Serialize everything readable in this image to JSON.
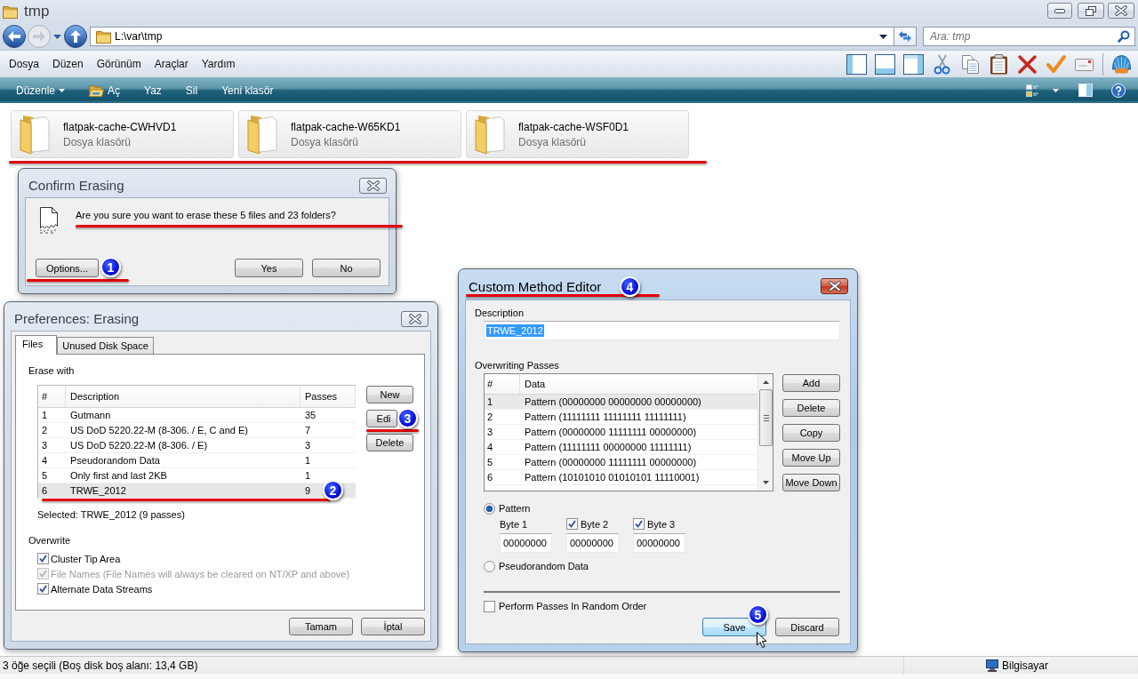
{
  "window": {
    "title": "tmp"
  },
  "address_bar": {
    "path": "L:\\var\\tmp",
    "search": {
      "placeholder": "Ara: tmp"
    }
  },
  "menu_bar": [
    "Dosya",
    "Düzen",
    "Görünüm",
    "Araçlar",
    "Yardım"
  ],
  "command_bar": [
    {
      "label": "Düzenle",
      "kind": "dropdown"
    },
    {
      "label": "Aç",
      "kind": "icon"
    },
    {
      "label": "Yaz",
      "kind": "plain"
    },
    {
      "label": "Sil",
      "kind": "plain"
    },
    {
      "label": "Yeni klasör",
      "kind": "plain"
    }
  ],
  "folders": {
    "underlined": true,
    "items": [
      {
        "name": "flatpak-cache-CWHVD1",
        "type": "Dosya klasörü"
      },
      {
        "name": "flatpak-cache-W65KD1",
        "type": "Dosya klasörü"
      },
      {
        "name": "flatpak-cache-WSF0D1",
        "type": "Dosya klasörü"
      }
    ]
  },
  "confirm_erasing": {
    "active": false,
    "title": "Confirm Erasing",
    "message": "Are you sure you want to erase these 5 files and 23 folders?",
    "message_underlined": true,
    "buttons": [
      {
        "label": "Options...",
        "underlined": true,
        "callout": "1"
      },
      {
        "label": "Yes",
        "underlined": false
      },
      {
        "label": "No",
        "underlined": false
      }
    ]
  },
  "preferences": {
    "active": false,
    "title": "Preferences: Erasing",
    "tabs": [
      {
        "label": "Files",
        "selected": true
      },
      {
        "label": "Unused Disk Space",
        "selected": false
      }
    ],
    "erase_with_label": "Erase with",
    "methods_table": {
      "columns": [
        "#",
        "Description",
        "Passes"
      ],
      "rows": [
        {
          "number": "1",
          "description": "Gutmann",
          "passes": "35",
          "selected": false,
          "underlined": false
        },
        {
          "number": "2",
          "description": "US DoD 5220.22-M (8-306. / E, C and E)",
          "passes": "7",
          "selected": false,
          "underlined": false
        },
        {
          "number": "3",
          "description": "US DoD 5220.22-M (8-306. / E)",
          "passes": "3",
          "selected": false,
          "underlined": false
        },
        {
          "number": "4",
          "description": "Pseudorandom Data",
          "passes": "1",
          "selected": false,
          "underlined": false
        },
        {
          "number": "5",
          "description": "Only first and last 2KB",
          "passes": "1",
          "selected": false,
          "underlined": false
        },
        {
          "number": "6",
          "description": "TRWE_2012",
          "passes": "9",
          "selected": true,
          "underlined": true,
          "callout": "2"
        }
      ]
    },
    "side_buttons": [
      {
        "label": "New",
        "underlined": false
      },
      {
        "label": "Edi",
        "underlined": true,
        "callout": "3"
      },
      {
        "label": "Delete",
        "underlined": false
      }
    ],
    "selected_summary": "Selected: TRWE_2012 (9 passes)",
    "overwrite_label": "Overwrite",
    "overwrite_options": [
      {
        "label": "Cluster Tip Area",
        "checked": true,
        "disabled": false
      },
      {
        "label": "File Names (File Names will always be cleared on NT/XP and above)",
        "checked": true,
        "disabled": true
      },
      {
        "label": "Alternate Data Streams",
        "checked": true,
        "disabled": false
      }
    ],
    "buttons": [
      "Tamam",
      "İptal"
    ]
  },
  "custom_method_editor": {
    "active": true,
    "title": "Custom Method Editor",
    "title_underlined": true,
    "title_callout": "4",
    "description_label": "Description",
    "description": {
      "value": "TRWE_2012",
      "text_selected": true
    },
    "passes_label": "Overwriting Passes",
    "passes_table": {
      "columns": [
        "#",
        "Data"
      ],
      "rows": [
        {
          "number": "1",
          "data": "Pattern (00000000 00000000 00000000)",
          "selected": true
        },
        {
          "number": "2",
          "data": "Pattern (11111111 11111111 11111111)",
          "selected": false
        },
        {
          "number": "3",
          "data": "Pattern (00000000 11111111 00000000)",
          "selected": false
        },
        {
          "number": "4",
          "data": "Pattern (11111111 00000000 11111111)",
          "selected": false
        },
        {
          "number": "5",
          "data": "Pattern (00000000 11111111 00000000)",
          "selected": false
        },
        {
          "number": "6",
          "data": "Pattern (10101010 01010101 11110001)",
          "selected": false
        }
      ]
    },
    "side_buttons": [
      "Add",
      "Delete",
      "Copy",
      "Move Up",
      "Move Down"
    ],
    "modes": [
      {
        "label": "Pattern",
        "selected": true
      },
      {
        "label": "Pseudorandom Data",
        "selected": false
      }
    ],
    "bytes": [
      {
        "label": "Byte 1",
        "kind": "label",
        "value": "00000000"
      },
      {
        "label": "Byte 2",
        "kind": "checkbox",
        "checked": true,
        "value": "00000000"
      },
      {
        "label": "Byte 3",
        "kind": "checkbox",
        "checked": true,
        "value": "00000000"
      }
    ],
    "random_order": {
      "label": "Perform Passes In Random Order",
      "checked": false
    },
    "buttons": [
      {
        "label": "Save",
        "hovered": true,
        "callout": "5"
      },
      {
        "label": "Discard",
        "hovered": false
      }
    ]
  },
  "status_bar": {
    "text": "3 öğe seçili (Boş disk boş alanı: 13,4 GB)",
    "location": "Bilgisayar"
  }
}
